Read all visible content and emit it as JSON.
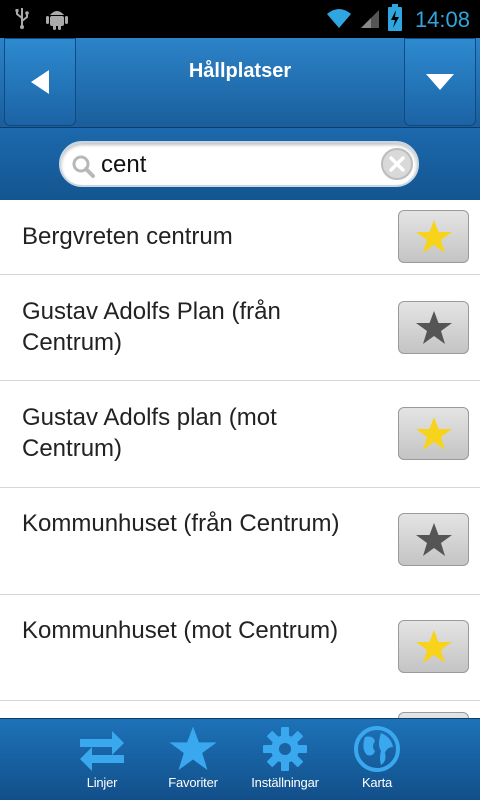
{
  "status_bar": {
    "time": "14:08",
    "icons": [
      "usb-icon",
      "android-debug-icon",
      "wifi-icon",
      "signal-icon",
      "battery-charging-icon"
    ]
  },
  "header": {
    "title": "Hållplatser",
    "back_icon": "arrow-left-icon",
    "menu_icon": "triangle-down-icon"
  },
  "search": {
    "value": "cent",
    "search_icon": "magnifier-icon",
    "clear_icon": "clear-x-icon"
  },
  "stops": [
    {
      "name": "Bergvreten centrum",
      "favorite": true
    },
    {
      "name": "Gustav Adolfs Plan (från Centrum)",
      "favorite": false
    },
    {
      "name": "Gustav Adolfs plan (mot Centrum)",
      "favorite": true
    },
    {
      "name": "Kommunhuset (från Centrum)",
      "favorite": false
    },
    {
      "name": "Kommunhuset (mot Centrum)",
      "favorite": true
    }
  ],
  "bottom_nav": [
    {
      "label": "Linjer",
      "icon": "swap-arrows-icon"
    },
    {
      "label": "Favoriter",
      "icon": "star-icon"
    },
    {
      "label": "Inställningar",
      "icon": "gear-icon"
    },
    {
      "label": "Karta",
      "icon": "globe-icon"
    }
  ],
  "colors": {
    "header_blue": "#1a5e9c",
    "nav_icon_blue": "#3aa8ef",
    "star_active": "#f7d31c",
    "star_inactive": "#555555",
    "time_blue": "#2fa6e0"
  }
}
